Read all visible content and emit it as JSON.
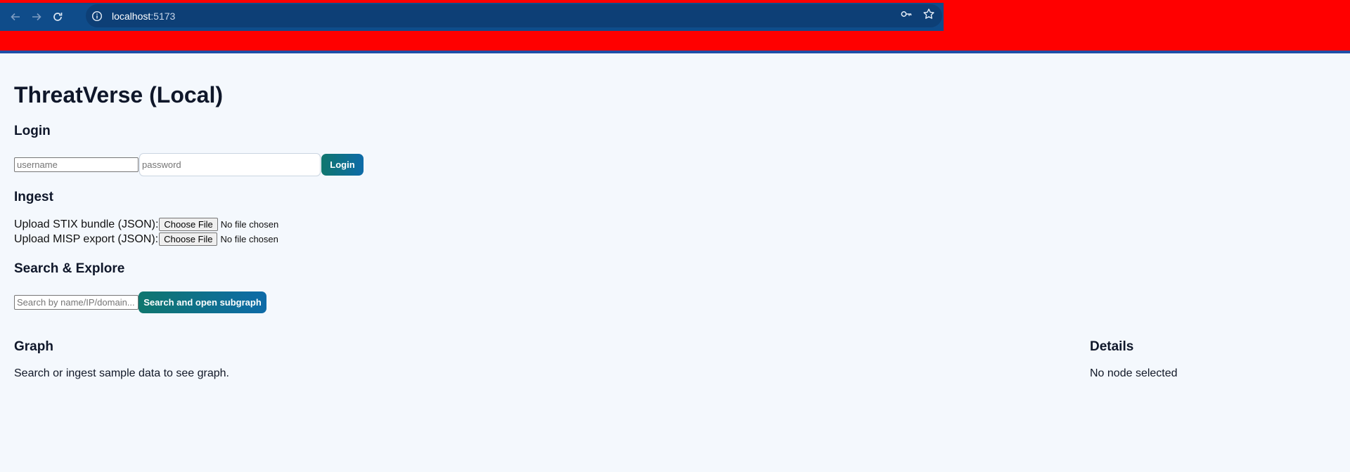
{
  "browser": {
    "url_host": "localhost",
    "url_port": ":5173"
  },
  "app": {
    "title": "ThreatVerse (Local)"
  },
  "login": {
    "heading": "Login",
    "username_placeholder": "username",
    "password_placeholder": "password",
    "button_label": "Login"
  },
  "ingest": {
    "heading": "Ingest",
    "stix_label": "Upload STIX bundle (JSON):",
    "misp_label": "Upload MISP export (JSON):",
    "choose_file_label": "Choose File",
    "no_file_text": "No file chosen"
  },
  "search": {
    "heading": "Search & Explore",
    "placeholder": "Search by name/IP/domain...",
    "button_label": "Search and open subgraph"
  },
  "graph": {
    "heading": "Graph",
    "empty_text": "Search or ingest sample data to see graph."
  },
  "details": {
    "heading": "Details",
    "empty_text": "No node selected"
  },
  "colors": {
    "chrome_toolbar": "#0f4c8a",
    "chrome_band": "#ff0000",
    "page_background": "#f4f8fd",
    "button_gradient_start": "#0f766e",
    "button_gradient_end": "#0e6ba8"
  },
  "icons": {
    "back": "arrow-left",
    "forward": "arrow-right",
    "reload": "refresh",
    "site_info": "info-circle",
    "password_manager": "key",
    "bookmark": "star"
  }
}
